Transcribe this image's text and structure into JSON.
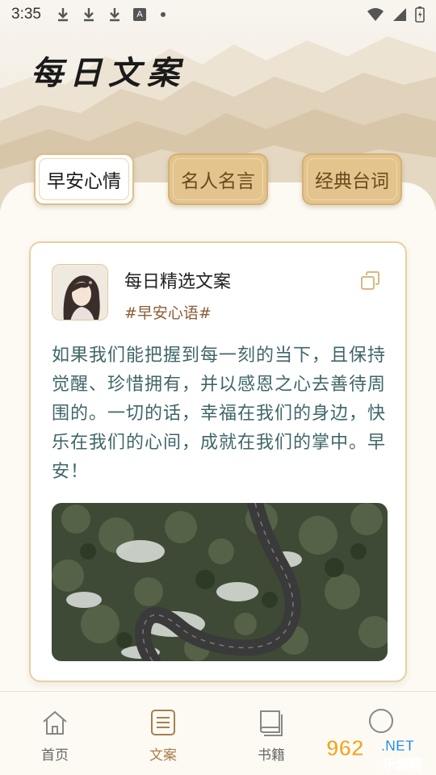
{
  "status_bar": {
    "time": "3:35"
  },
  "header": {
    "title": "每日文案"
  },
  "tabs": [
    {
      "label": "早安心情",
      "active": true
    },
    {
      "label": "名人名言",
      "active": false
    },
    {
      "label": "经典台词",
      "active": false
    }
  ],
  "card": {
    "title": "每日精选文案",
    "tag": "#早安心语#",
    "text": "如果我们能把握到每一刻的当下，且保持觉醒、珍惜拥有，并以感恩之心去善待周围的。一切的话，幸福在我们的身边，快乐在我们的心间，成就在我们的掌中。早安！"
  },
  "bottom_nav": [
    {
      "label": "首页",
      "icon": "home-icon",
      "active": false
    },
    {
      "label": "文案",
      "icon": "document-icon",
      "active": true
    },
    {
      "label": "书籍",
      "icon": "book-icon",
      "active": false
    },
    {
      "label": "",
      "icon": "profile-icon",
      "active": false
    }
  ],
  "watermark": {
    "brand_number": "962",
    "suffix": ".NET",
    "site_name": "乐游网"
  },
  "colors": {
    "accent": "#a8804a",
    "tab_gold": "#e3c48d",
    "text_teal": "#3f6668",
    "tag_brown": "#8a5e36"
  }
}
